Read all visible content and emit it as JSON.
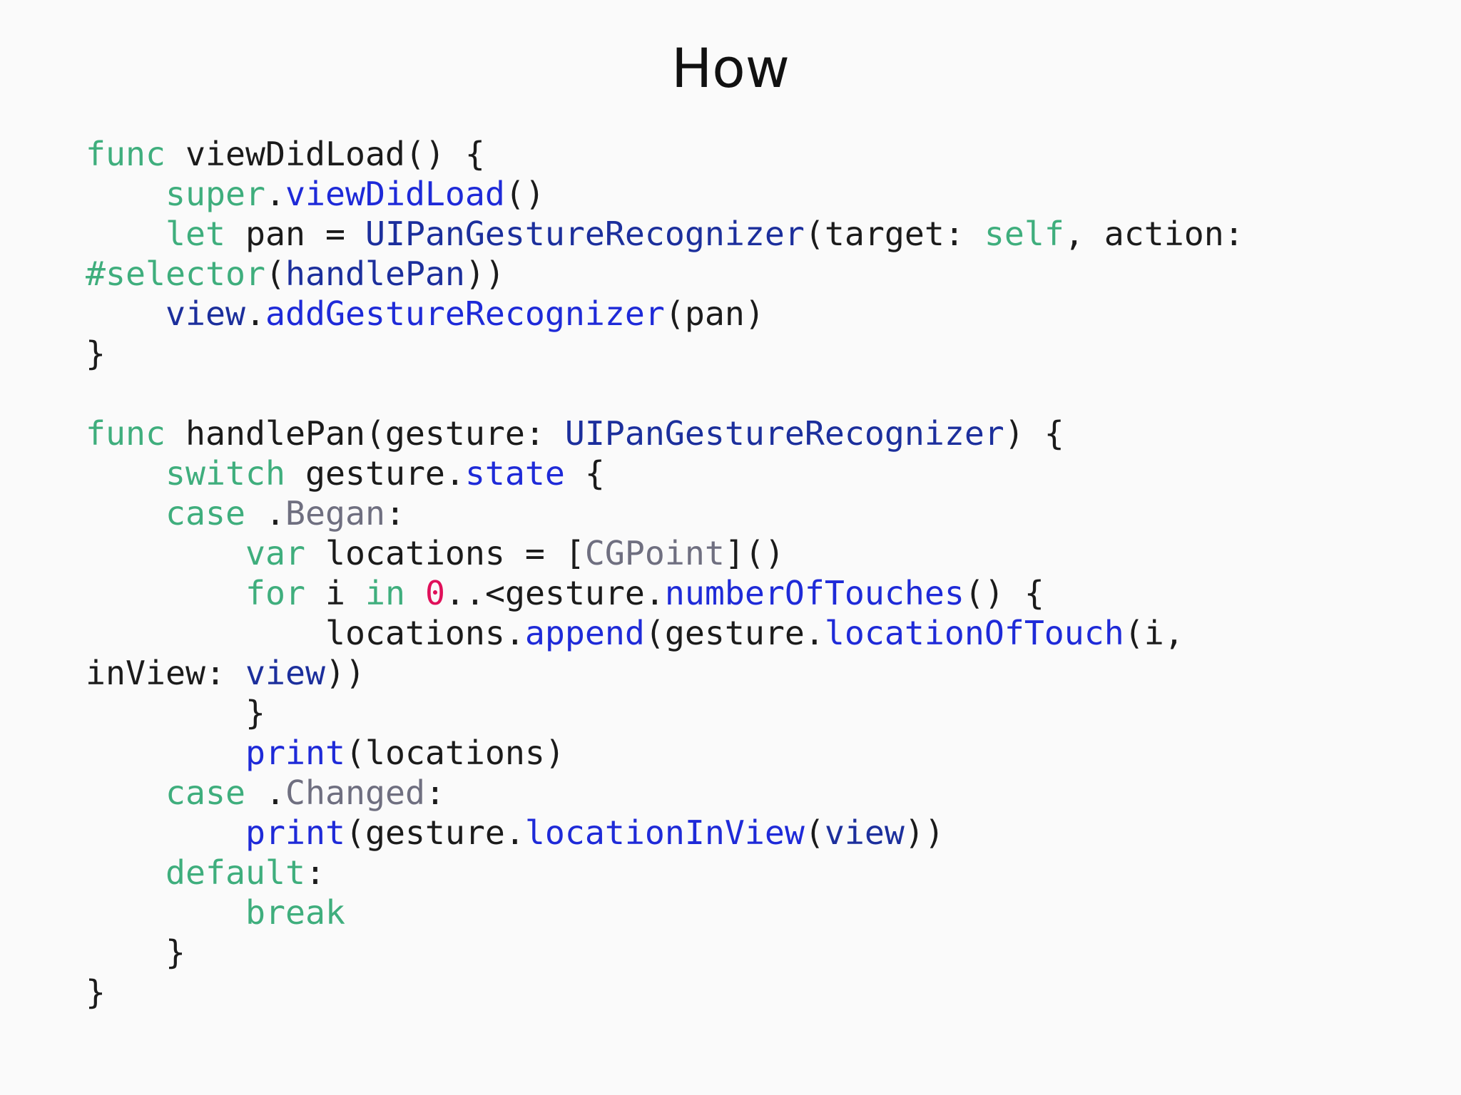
{
  "slide": {
    "title": "How"
  },
  "colors": {
    "background": "#fafafa",
    "keyword": "#3fae7d",
    "method": "#1e2ad8",
    "type": "#1c2f9c",
    "enum": "#6f6f80",
    "number": "#e0105a",
    "plain": "#1b1b1b"
  },
  "code": {
    "language": "swift",
    "lines": [
      [
        {
          "t": "keyword",
          "s": "func"
        },
        {
          "t": "plain",
          "s": " viewDidLoad() {"
        }
      ],
      [
        {
          "t": "plain",
          "s": "    "
        },
        {
          "t": "keyword",
          "s": "super"
        },
        {
          "t": "plain",
          "s": "."
        },
        {
          "t": "method",
          "s": "viewDidLoad"
        },
        {
          "t": "plain",
          "s": "()"
        }
      ],
      [
        {
          "t": "plain",
          "s": "    "
        },
        {
          "t": "keyword",
          "s": "let"
        },
        {
          "t": "plain",
          "s": " pan = "
        },
        {
          "t": "type",
          "s": "UIPanGestureRecognizer"
        },
        {
          "t": "plain",
          "s": "(target: "
        },
        {
          "t": "keyword",
          "s": "self"
        },
        {
          "t": "plain",
          "s": ", action:"
        }
      ],
      [
        {
          "t": "keyword",
          "s": "#selector"
        },
        {
          "t": "plain",
          "s": "("
        },
        {
          "t": "type",
          "s": "handlePan"
        },
        {
          "t": "plain",
          "s": "))"
        }
      ],
      [
        {
          "t": "plain",
          "s": "    "
        },
        {
          "t": "type",
          "s": "view"
        },
        {
          "t": "plain",
          "s": "."
        },
        {
          "t": "method",
          "s": "addGestureRecognizer"
        },
        {
          "t": "plain",
          "s": "(pan)"
        }
      ],
      [
        {
          "t": "plain",
          "s": "}"
        }
      ],
      [],
      [
        {
          "t": "keyword",
          "s": "func"
        },
        {
          "t": "plain",
          "s": " handlePan(gesture: "
        },
        {
          "t": "type",
          "s": "UIPanGestureRecognizer"
        },
        {
          "t": "plain",
          "s": ") {"
        }
      ],
      [
        {
          "t": "plain",
          "s": "    "
        },
        {
          "t": "keyword",
          "s": "switch"
        },
        {
          "t": "plain",
          "s": " gesture."
        },
        {
          "t": "method",
          "s": "state"
        },
        {
          "t": "plain",
          "s": " {"
        }
      ],
      [
        {
          "t": "plain",
          "s": "    "
        },
        {
          "t": "keyword",
          "s": "case"
        },
        {
          "t": "plain",
          "s": " ."
        },
        {
          "t": "enum",
          "s": "Began"
        },
        {
          "t": "plain",
          "s": ":"
        }
      ],
      [
        {
          "t": "plain",
          "s": "        "
        },
        {
          "t": "keyword",
          "s": "var"
        },
        {
          "t": "plain",
          "s": " locations = ["
        },
        {
          "t": "enum",
          "s": "CGPoint"
        },
        {
          "t": "plain",
          "s": "]()"
        }
      ],
      [
        {
          "t": "plain",
          "s": "        "
        },
        {
          "t": "keyword",
          "s": "for"
        },
        {
          "t": "plain",
          "s": " i "
        },
        {
          "t": "keyword",
          "s": "in"
        },
        {
          "t": "plain",
          "s": " "
        },
        {
          "t": "number",
          "s": "0"
        },
        {
          "t": "plain",
          "s": "..<gesture."
        },
        {
          "t": "method",
          "s": "numberOfTouches"
        },
        {
          "t": "plain",
          "s": "() {"
        }
      ],
      [
        {
          "t": "plain",
          "s": "            locations."
        },
        {
          "t": "method",
          "s": "append"
        },
        {
          "t": "plain",
          "s": "(gesture."
        },
        {
          "t": "method",
          "s": "locationOfTouch"
        },
        {
          "t": "plain",
          "s": "(i,"
        }
      ],
      [
        {
          "t": "plain",
          "s": "inView: "
        },
        {
          "t": "type",
          "s": "view"
        },
        {
          "t": "plain",
          "s": "))"
        }
      ],
      [
        {
          "t": "plain",
          "s": "        }"
        }
      ],
      [
        {
          "t": "plain",
          "s": "        "
        },
        {
          "t": "method",
          "s": "print"
        },
        {
          "t": "plain",
          "s": "(locations)"
        }
      ],
      [
        {
          "t": "plain",
          "s": "    "
        },
        {
          "t": "keyword",
          "s": "case"
        },
        {
          "t": "plain",
          "s": " ."
        },
        {
          "t": "enum",
          "s": "Changed"
        },
        {
          "t": "plain",
          "s": ":"
        }
      ],
      [
        {
          "t": "plain",
          "s": "        "
        },
        {
          "t": "method",
          "s": "print"
        },
        {
          "t": "plain",
          "s": "(gesture."
        },
        {
          "t": "method",
          "s": "locationInView"
        },
        {
          "t": "plain",
          "s": "("
        },
        {
          "t": "type",
          "s": "view"
        },
        {
          "t": "plain",
          "s": "))"
        }
      ],
      [
        {
          "t": "plain",
          "s": "    "
        },
        {
          "t": "keyword",
          "s": "default"
        },
        {
          "t": "plain",
          "s": ":"
        }
      ],
      [
        {
          "t": "plain",
          "s": "        "
        },
        {
          "t": "keyword",
          "s": "break"
        }
      ],
      [
        {
          "t": "plain",
          "s": "    }"
        }
      ],
      [
        {
          "t": "plain",
          "s": "}"
        }
      ]
    ]
  }
}
